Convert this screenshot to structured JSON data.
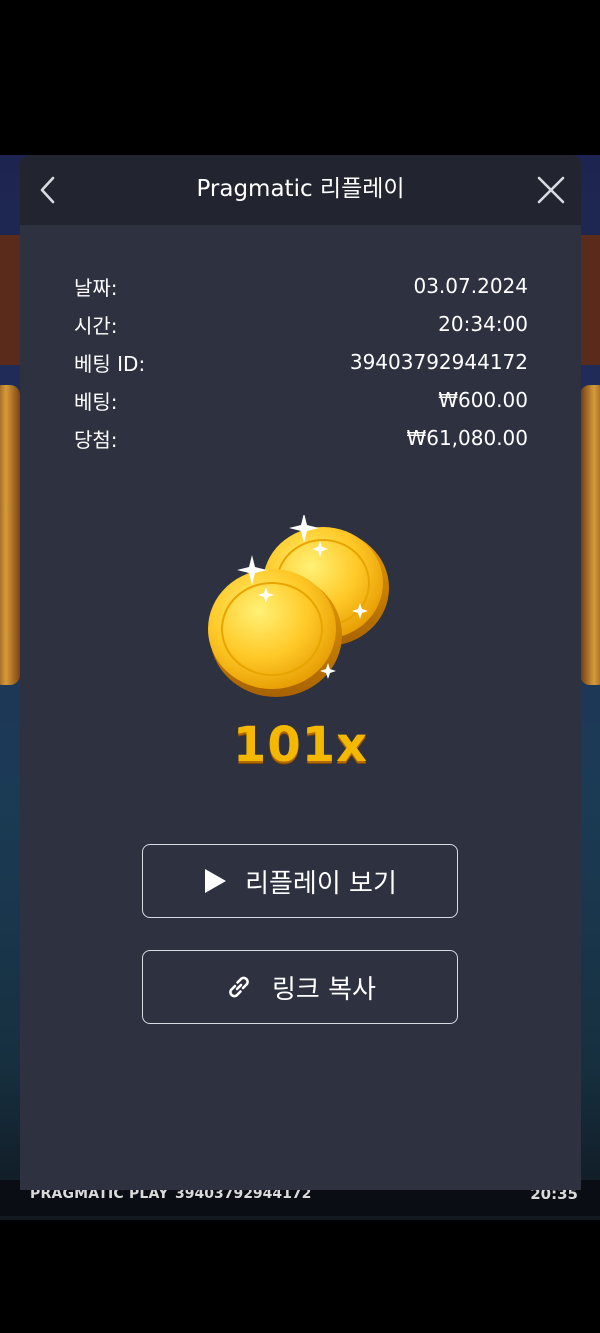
{
  "modal": {
    "title": "Pragmatic 리플레이",
    "back_icon": "chevron-left-icon",
    "close_icon": "close-icon"
  },
  "info": [
    {
      "label": "날짜:",
      "value": "03.07.2024"
    },
    {
      "label": "시간:",
      "value": "20:34:00"
    },
    {
      "label": "베팅 ID:",
      "value": "39403792944172"
    },
    {
      "label": "베팅:",
      "value": "₩600.00"
    },
    {
      "label": "당첨:",
      "value": "₩61,080.00"
    }
  ],
  "win": {
    "icon": "gold-coins-icon",
    "multiplier": "101x"
  },
  "buttons": {
    "replay_label": "리플레이 보기",
    "replay_icon": "play-icon",
    "copy_label": "링크 복사",
    "copy_icon": "link-icon"
  },
  "footer": {
    "brand": "PRAGMATIC PLAY",
    "id": "39403792944172",
    "time": "20:35"
  },
  "colors": {
    "modal_bg": "#2d3140",
    "header_bg": "#22252f",
    "multiplier": "#f5b800",
    "button_border": "#d8dbe3"
  }
}
